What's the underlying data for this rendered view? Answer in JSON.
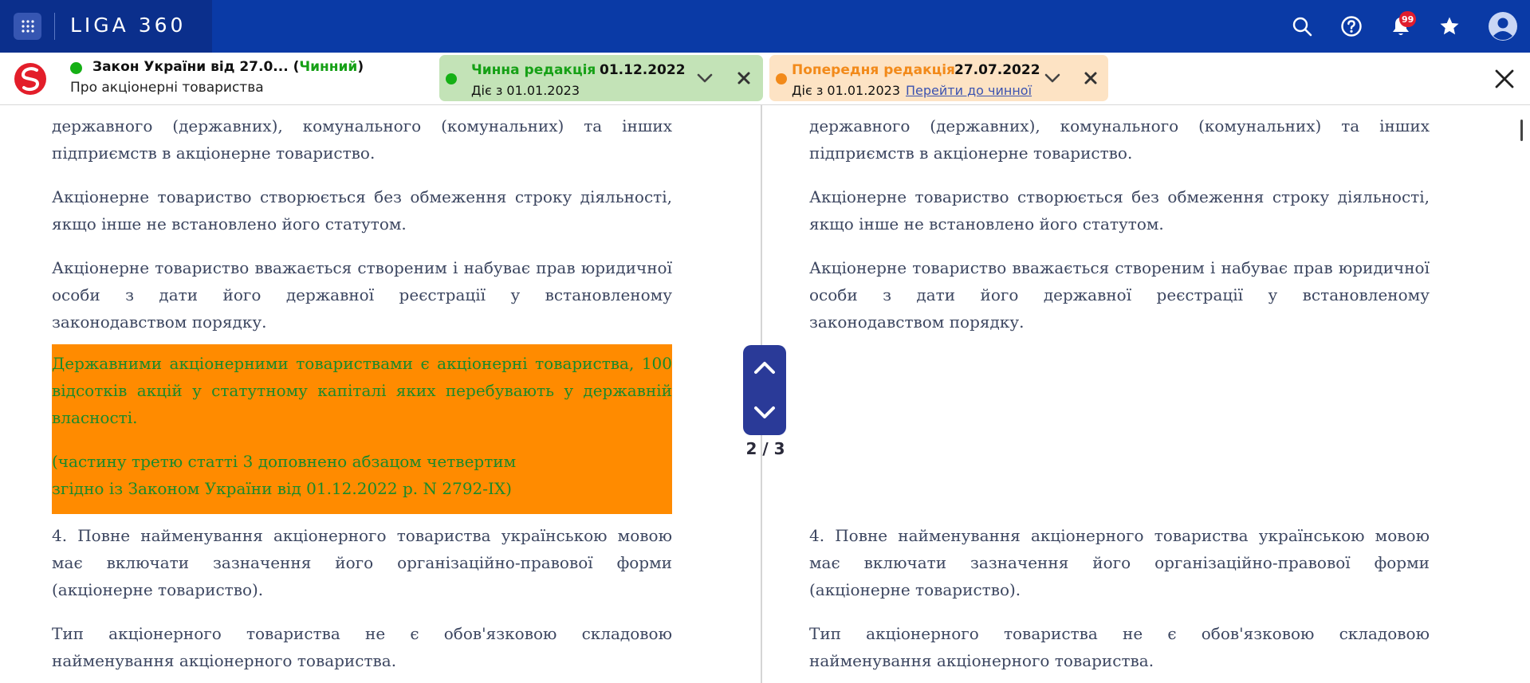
{
  "app": {
    "brand": "LIGA 360",
    "notifications_count": "99",
    "colors": {
      "topbar": "#0a3aa6",
      "brand_block": "#0b2f8c",
      "highlight": "#ff8b00",
      "current_green": "#16a016",
      "previous_orange": "#f28a1a"
    }
  },
  "document": {
    "title": "Закон України від 27.0...",
    "status_open": "(",
    "status": "Чинний",
    "status_close": ")",
    "subtitle": "Про акціонерні товариства"
  },
  "editions": {
    "current": {
      "label": "Чинна редакція",
      "date": "01.12.2022",
      "valid_from": "Діє з 01.01.2023"
    },
    "previous": {
      "label": "Попередня редакція",
      "date": "27.07.2022",
      "valid_from": "Діє з 01.01.2023",
      "link": "Перейти до чинної"
    }
  },
  "navigator": {
    "count": "2 / 3"
  },
  "left_column": {
    "p0": "державного (державних), комунального (комунальних) та інших підприємств в акціонерне товариство.",
    "p1": "Акціонерне товариство створюється без обмеження строку діяльності, якщо інше не встановлено його статутом.",
    "p2": "Акціонерне товариство вважається створеним і набуває прав юридичної особи з дати його державної реєстрації у встановленому законодавством порядку.",
    "h1": "Державними акціонерними товариствами є акціонерні товариства, 100 відсотків акцій у статутному капіталі яких перебувають у державній власності.",
    "h2_line1": "(частину третю статті 3 доповнено абзацом четвертим",
    "h2_line2": "згідно із Законом України від 01.12.2022 р. N 2792-IX)",
    "p3": "4. Повне найменування акціонерного товариства українською мовою має включати зазначення його організаційно-правової форми (акціонерне товариство).",
    "p4": "Тип акціонерного товариства не є обов'язковою складовою найменування акціонерного товариства."
  },
  "right_column": {
    "p0": "державного (державних), комунального (комунальних) та інших підприємств в акціонерне товариство.",
    "p1": "Акціонерне товариство створюється без обмеження строку діяльності, якщо інше не встановлено його статутом.",
    "p2": "Акціонерне товариство вважається створеним і набуває прав юридичної особи з дати його державної реєстрації у встановленому законодавством порядку.",
    "p3": "4. Повне найменування акціонерного товариства українською мовою має включати зазначення його організаційно-правової форми (акціонерне товариство).",
    "p4": "Тип акціонерного товариства не є обов'язковою складовою найменування акціонерного товариства."
  }
}
